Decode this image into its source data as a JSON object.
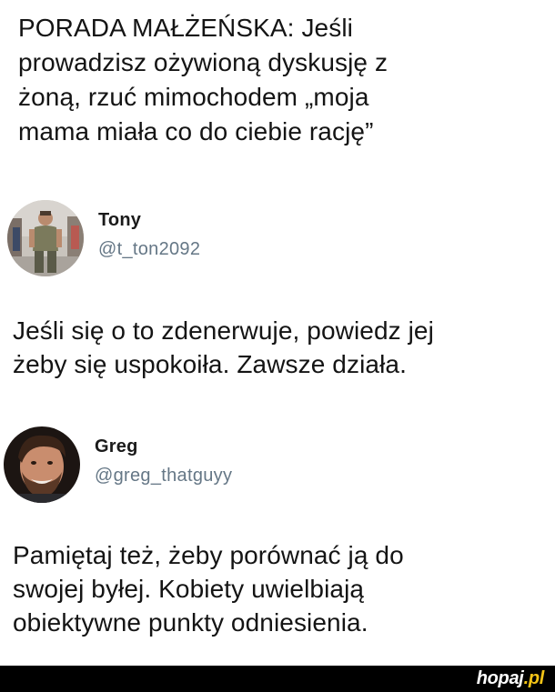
{
  "first_post": {
    "text": "PORADA MAŁŻEŃSKA: Jeśli\nprowadzisz ożywioną dyskusję z\nżoną, rzuć mimochodem „moja\nmama miała co do ciebie rację”"
  },
  "reply_tony": {
    "display_name": "Tony",
    "handle": "@t_ton2092",
    "avatar_icon": "person-standing-street-avatar",
    "text": "Jeśli się o to zdenerwuje, powiedz jej\nżeby się uspokoiła. Zawsze działa."
  },
  "reply_greg": {
    "display_name": "Greg",
    "handle": "@greg_thatguyy",
    "avatar_icon": "smiling-man-avatar",
    "text": "Pamiętaj też, żeby porównać ją do\nswojej byłej. Kobiety uwielbiają\nobiektywne punkty odniesienia."
  },
  "footer": {
    "watermark_name": "hopaj",
    "watermark_tld": ".pl",
    "background_color": "#000000",
    "accent_color": "#f2c316"
  }
}
